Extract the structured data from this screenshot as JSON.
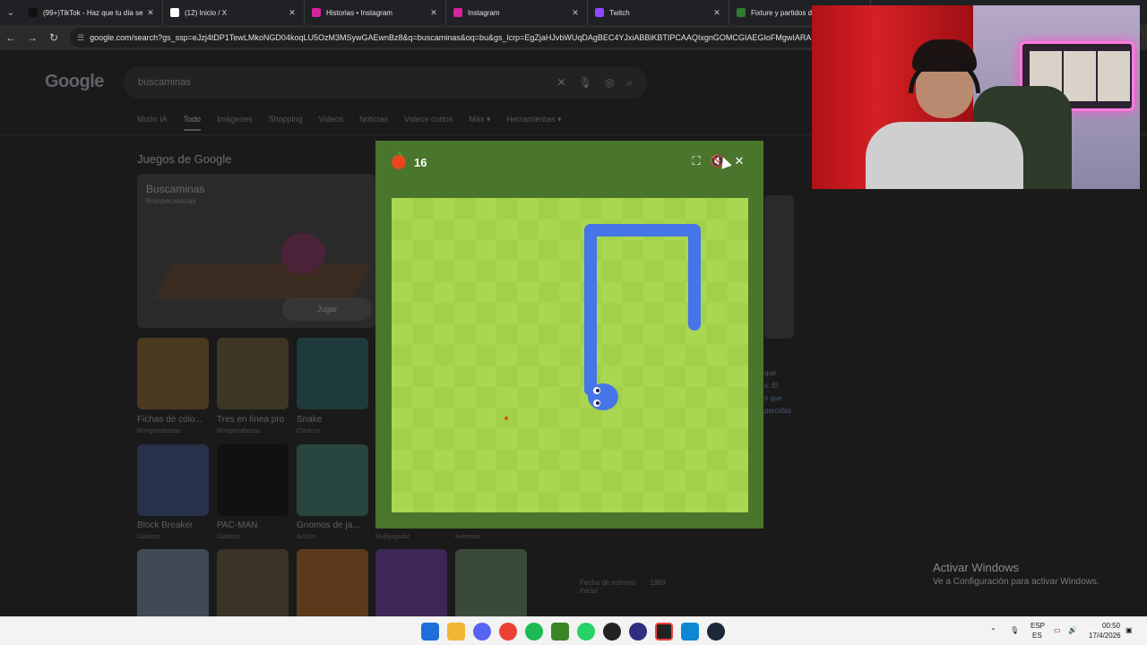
{
  "browser": {
    "tabs": [
      {
        "title": "(99+)TikTok - Haz que tu día se",
        "icon": "tiktok-icon",
        "color": "#111111"
      },
      {
        "title": "(12) Inicio / X",
        "icon": "x-icon",
        "color": "#ffffff"
      },
      {
        "title": "Historias • Instagram",
        "icon": "instagram-icon",
        "color": "#d6249f"
      },
      {
        "title": "Instagram",
        "icon": "instagram-icon",
        "color": "#d6249f"
      },
      {
        "title": "Twitch",
        "icon": "twitch-icon",
        "color": "#9146ff"
      },
      {
        "title": "Fixture y partidos d",
        "icon": "fixture-icon",
        "color": "#2e7d32"
      }
    ],
    "url": "google.com/search?gs_ssp=eJzj4tDP1TewLMkoNGD04koqLU5OzM3MSywGAEwnBz8&q=buscaminas&oq=bu&gs_lcrp=EgZjaHJvbWUqDAgBEC4YJxiABBiKBTIPCAAQIxgnGOMCGIAEGIoFMgwIARA"
  },
  "google": {
    "logo": "Google",
    "query": "buscaminas",
    "tabs": [
      "Modo IA",
      "Todo",
      "Imágenes",
      "Shopping",
      "Videos",
      "Noticias",
      "Videos cortos",
      "Más ▾",
      "Herramientas ▾"
    ],
    "section_title": "Juegos de Google",
    "hero": {
      "title": "Buscaminas",
      "subtitle": "Rompecabezas",
      "play_label": "Jugar"
    },
    "games_row1": [
      {
        "label": "Fichas de colo...",
        "sub": "Rompecabezas"
      },
      {
        "label": "Tres en línea pro",
        "sub": "Rompecabezas"
      },
      {
        "label": "Snake",
        "sub": "Clásicos"
      }
    ],
    "games_row2": [
      {
        "label": "Block Breaker",
        "sub": "Clásicos"
      },
      {
        "label": "PAC-MAN",
        "sub": "Clásicos"
      },
      {
        "label": "Gnomos de ja...",
        "sub": "Acción"
      },
      {
        "label": "",
        "sub": "Multijugador"
      },
      {
        "label": "",
        "sub": "Aventura"
      }
    ],
    "side_snippet": [
      "que",
      "s. El",
      "s que",
      "parcidas"
    ],
    "info_label": "Fecha de estreno inicial",
    "info_value": "1989"
  },
  "snake": {
    "score": "16",
    "apple_color": "#e7471d",
    "snake_color": "#4674e9",
    "board_light": "#aad751",
    "board_dark": "#a2d149"
  },
  "windows": {
    "activate_title": "Activar Windows",
    "activate_sub": "Ve a Configuración para activar Windows.",
    "lang1": "ESP",
    "lang2": "ES",
    "time": "00:50",
    "date": "17/4/2026"
  }
}
